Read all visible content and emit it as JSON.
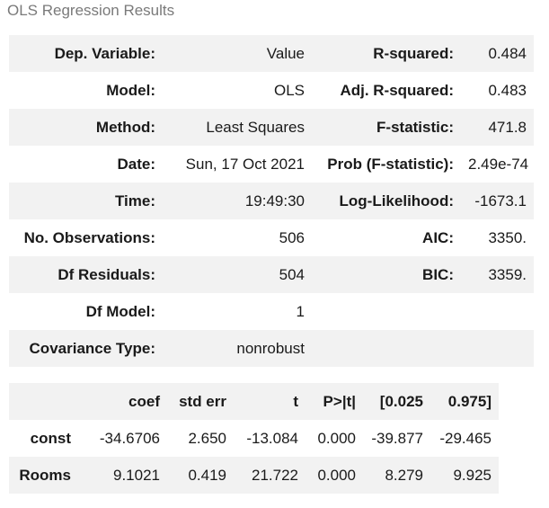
{
  "caption": "OLS Regression Results",
  "summary": [
    {
      "l1": "Dep. Variable:",
      "v1": "Value",
      "l2": "R-squared:",
      "v2": "0.484"
    },
    {
      "l1": "Model:",
      "v1": "OLS",
      "l2": "Adj. R-squared:",
      "v2": "0.483"
    },
    {
      "l1": "Method:",
      "v1": "Least Squares",
      "l2": "F-statistic:",
      "v2": "471.8"
    },
    {
      "l1": "Date:",
      "v1": "Sun, 17 Oct 2021",
      "l2": "Prob (F-statistic):",
      "v2": "2.49e-74"
    },
    {
      "l1": "Time:",
      "v1": "19:49:30",
      "l2": "Log-Likelihood:",
      "v2": "-1673.1"
    },
    {
      "l1": "No. Observations:",
      "v1": "506",
      "l2": "AIC:",
      "v2": "3350."
    },
    {
      "l1": "Df Residuals:",
      "v1": "504",
      "l2": "BIC:",
      "v2": "3359."
    },
    {
      "l1": "Df Model:",
      "v1": "1",
      "l2": "",
      "v2": ""
    },
    {
      "l1": "Covariance Type:",
      "v1": "nonrobust",
      "l2": "",
      "v2": ""
    }
  ],
  "coef_table": {
    "headers": [
      "",
      "coef",
      "std err",
      "t",
      "P>|t|",
      "[0.025",
      "0.975]"
    ],
    "rows": [
      [
        "const",
        "-34.6706",
        "2.650",
        "-13.084",
        "0.000",
        "-39.877",
        "-29.465"
      ],
      [
        "Rooms",
        "9.1021",
        "0.419",
        "21.722",
        "0.000",
        "8.279",
        "9.925"
      ]
    ]
  }
}
